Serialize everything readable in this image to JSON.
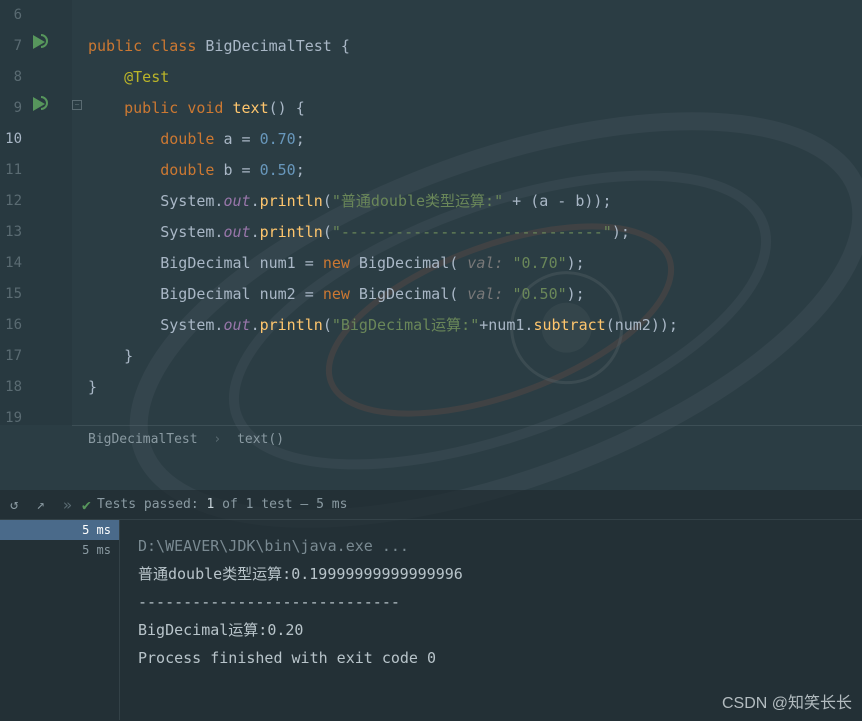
{
  "lineNumbers": [
    "6",
    "7",
    "8",
    "9",
    "10",
    "11",
    "12",
    "13",
    "14",
    "15",
    "16",
    "17",
    "18",
    "19"
  ],
  "activeLine": "10",
  "code": {
    "l7": {
      "public": "public",
      "class": "class",
      "name": "BigDecimalTest",
      "brace": " {"
    },
    "l8": {
      "anno": "@Test"
    },
    "l9": {
      "public": "public",
      "void": "void",
      "method": "text",
      "parens": "() {"
    },
    "l10": {
      "type": "double",
      "var": "a",
      "eq": " = ",
      "val": "0.70",
      "semi": ";"
    },
    "l11": {
      "type": "double",
      "var": "b",
      "eq": " = ",
      "val": "0.50",
      "semi": ";"
    },
    "l12": {
      "sys": "System.",
      "out": "out",
      "dot": ".",
      "println": "println",
      "open": "(",
      "str": "\"普通double类型运算:\"",
      "plus": " + (",
      "a": "a",
      "minus": " - ",
      "b": "b",
      "close": "));"
    },
    "l13": {
      "sys": "System.",
      "out": "out",
      "dot": ".",
      "println": "println",
      "open": "(",
      "str": "\"-----------------------------\"",
      "close": ");"
    },
    "l14": {
      "type": "BigDecimal",
      "var": "num1",
      "eq": " = ",
      "new": "new",
      "ctor": " BigDecimal(",
      "hint": " val: ",
      "val": "\"0.70\"",
      "close": ");"
    },
    "l15": {
      "type": "BigDecimal",
      "var": "num2",
      "eq": " = ",
      "new": "new",
      "ctor": " BigDecimal(",
      "hint": " val: ",
      "val": "\"0.50\"",
      "close": ");"
    },
    "l16": {
      "sys": "System.",
      "out": "out",
      "dot": ".",
      "println": "println",
      "open": "(",
      "str": "\"BigDecimal运算:\"",
      "plus": "+",
      "v1": "num1",
      "dot2": ".",
      "sub": "subtract",
      "open2": "(",
      "v2": "num2",
      "close": "));"
    },
    "l17": {
      "brace": "}"
    },
    "l18": {
      "brace": "}"
    }
  },
  "breadcrumb": {
    "class": "BigDecimalTest",
    "method": "text()"
  },
  "testPanel": {
    "status": {
      "prefix": "Tests passed: ",
      "passed": "1",
      "mid": " of 1 test – ",
      "time": "5 ms"
    },
    "tree": [
      {
        "label": "5 ms",
        "selected": true
      },
      {
        "label": "5 ms",
        "selected": false
      }
    ],
    "console": [
      "D:\\WEAVER\\JDK\\bin\\java.exe ...",
      "普通double类型运算:0.19999999999999996",
      "-----------------------------",
      "BigDecimal运算:0.20",
      "",
      "Process finished with exit code 0"
    ]
  },
  "watermark": "CSDN @知笑长长"
}
